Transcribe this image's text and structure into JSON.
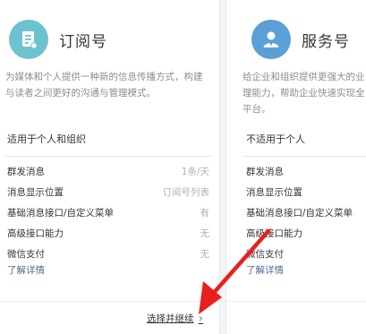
{
  "subscription": {
    "title": "订阅号",
    "icon": "document-icon",
    "description": "为媒体和个人提供一种新的信息传播方式，构建与读者之间更好的沟通与管理模式。",
    "scope": "适用于个人和组织",
    "features": [
      {
        "name": "群发消息",
        "value": "1条/天"
      },
      {
        "name": "消息显示位置",
        "value": "订阅号列表"
      },
      {
        "name": "基础消息接口/自定义菜单",
        "value": "有"
      },
      {
        "name": "高级接口能力",
        "value": "无"
      },
      {
        "name": "微信支付",
        "value": "无"
      }
    ],
    "more_link": "了解详情",
    "select_label": "选择并继续"
  },
  "service": {
    "title": "服务号",
    "icon": "user-icon",
    "description_lines": [
      "给企业和组织提供更强大的业",
      "理能力，帮助企业快速实现全",
      "平台。"
    ],
    "scope": "不适用于个人",
    "features": [
      {
        "name": "群发消息"
      },
      {
        "name": "消息显示位置"
      },
      {
        "name": "基础消息接口/自定义菜单"
      },
      {
        "name": "高级接口能力"
      },
      {
        "name": "微信支付"
      }
    ],
    "more_link": "了解详情"
  },
  "colors": {
    "subscription_logo": "#6cc3cf",
    "service_logo": "#5a9fd6",
    "annotation_arrow": "#e8211d",
    "link": "#576b95"
  }
}
